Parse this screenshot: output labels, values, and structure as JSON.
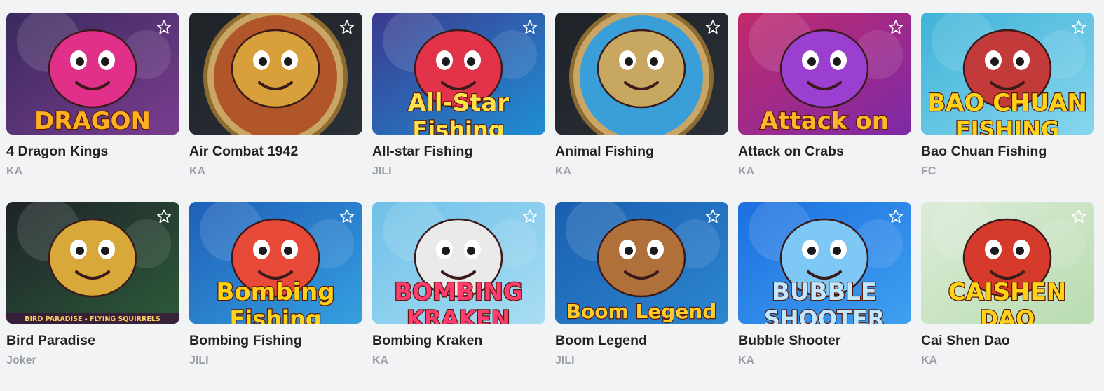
{
  "games": [
    {
      "name": "4 Dragon Kings",
      "provider": "KA",
      "art_text": "DRAGON",
      "bg": [
        "#3a2a5e",
        "#7a3d8f"
      ],
      "accent": "#e0308a",
      "text_color": "#ffb020",
      "icon": "dragon-icon"
    },
    {
      "name": "Air Combat 1942",
      "provider": "KA",
      "art_text": "",
      "bg": [
        "#1e2328",
        "#2a3037"
      ],
      "accent": "#d8a03a",
      "text_color": "#ffcc33",
      "icon": "plane-icon"
    },
    {
      "name": "All-star Fishing",
      "provider": "JILI",
      "art_text": "All-Star",
      "art_subtext": "Fishing",
      "bg": [
        "#3b3a8f",
        "#1f8fd4"
      ],
      "accent": "#e2334a",
      "text_color": "#ffe14a",
      "icon": "monster-icon"
    },
    {
      "name": "Animal Fishing",
      "provider": "KA",
      "art_text": "",
      "bg": [
        "#1e2328",
        "#2a3037"
      ],
      "accent": "#c8a860",
      "text_color": "#ffffff",
      "icon": "raccoon-icon"
    },
    {
      "name": "Attack on Crabs",
      "provider": "KA",
      "art_text": "Attack on",
      "bg": [
        "#c12a6a",
        "#7d2aa8"
      ],
      "accent": "#9b3fd0",
      "text_color": "#ffb72a",
      "icon": "crab-icon"
    },
    {
      "name": "Bao Chuan Fishing",
      "provider": "FC",
      "art_text": "BAO CHUAN",
      "art_subtext": "FISHING",
      "bg": [
        "#3fb3d8",
        "#88d6ee"
      ],
      "accent": "#c23a3a",
      "text_color": "#ffd21a",
      "icon": "ship-icon"
    },
    {
      "name": "Bird Paradise",
      "provider": "Joker",
      "art_text": "BIRD PARADISE - FLYING SQUIRRELS",
      "bg": [
        "#1e2328",
        "#2d5a3a"
      ],
      "accent": "#d8a83a",
      "text_color": "#f0d070",
      "icon": "bird-icon"
    },
    {
      "name": "Bombing Fishing",
      "provider": "JILI",
      "art_text": "Bombing",
      "art_subtext": "Fishing",
      "bg": [
        "#1f5fb8",
        "#35a0e0"
      ],
      "accent": "#e84a3a",
      "text_color": "#ffd21a",
      "icon": "fish-icon"
    },
    {
      "name": "Bombing Kraken",
      "provider": "KA",
      "art_text": "BOMBING",
      "art_subtext": "KRAKEN",
      "bg": [
        "#6fc0e8",
        "#a8ddf3"
      ],
      "accent": "#eaeaea",
      "text_color": "#ff3d6e",
      "icon": "kraken-icon"
    },
    {
      "name": "Boom Legend",
      "provider": "JILI",
      "art_text": "Boom Legend",
      "bg": [
        "#1a5fb0",
        "#2c86d0"
      ],
      "accent": "#b0703a",
      "text_color": "#ffcc2a",
      "icon": "pirate-icon"
    },
    {
      "name": "Bubble Shooter",
      "provider": "KA",
      "art_text": "BUBBLE",
      "art_subtext": "SHOOTER",
      "bg": [
        "#1c6fe0",
        "#3fa0f0"
      ],
      "accent": "#7ec8f5",
      "text_color": "#bfe8ff",
      "icon": "girl-icon"
    },
    {
      "name": "Cai Shen Dao",
      "provider": "KA",
      "art_text": "CAISHEN",
      "art_subtext": "DAO",
      "bg": [
        "#dcecd8",
        "#b9dcb0"
      ],
      "accent": "#d63a2a",
      "text_color": "#ffd21a",
      "icon": "god-of-wealth-icon"
    }
  ],
  "favorite_icon": "star-outline-icon"
}
